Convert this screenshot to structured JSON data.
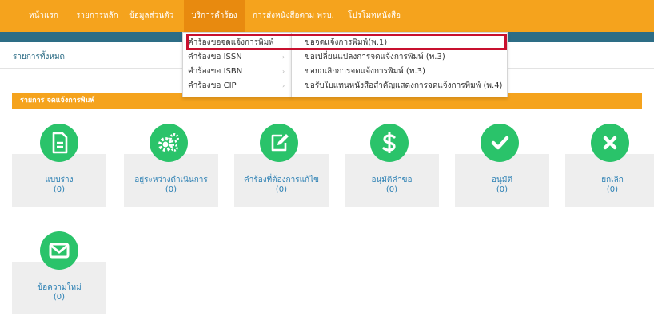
{
  "nav": {
    "items": [
      "หน้าแรก",
      "รายการหลัก",
      "ข้อมูลส่วนตัว",
      "บริการคำร้อง",
      "การส่งหนังสือตาม พรบ.",
      "โปรโมทหนังสือ"
    ]
  },
  "page": {
    "title": "รายการทั้งหมด"
  },
  "section": {
    "label": "รายการ จดแจ้งการพิมพ์"
  },
  "cards": [
    {
      "label": "แบบร่าง",
      "count": "(0)",
      "icon": "document-icon"
    },
    {
      "label": "อยู่ระหว่างดำเนินการ",
      "count": "(0)",
      "icon": "gears-icon"
    },
    {
      "label": "คำร้องที่ต้องการแก้ไข",
      "count": "(0)",
      "icon": "edit-icon"
    },
    {
      "label": "อนุมัติคำขอ",
      "count": "(0)",
      "icon": "dollar-icon"
    },
    {
      "label": "อนุมัติ",
      "count": "(0)",
      "icon": "check-icon"
    },
    {
      "label": "ยกเลิก",
      "count": "(0)",
      "icon": "x-icon"
    },
    {
      "label": "ข้อความใหม่",
      "count": "(0)",
      "icon": "envelope-icon"
    }
  ],
  "menu": {
    "level1": [
      "คำร้องขอจดแจ้งการพิมพ์",
      "คำร้องขอ ISSN",
      "คำร้องขอ ISBN",
      "คำร้องขอ CIP"
    ],
    "level2": [
      "ขอจดแจ้งการพิมพ์(พ.1)",
      "ขอเปลี่ยนแปลงการจดแจ้งการพิมพ์ (พ.3)",
      "ขอยกเลิกการจดแจ้งการพิมพ์ (พ.3)",
      "ขอรับใบแทนหนังสือสำคัญแสดงการจดแจ้งการพิมพ์ (พ.4)"
    ],
    "arrow": "›"
  },
  "colors": {
    "nav": "#f5a31d",
    "teal": "#2d6d86",
    "card_circle": "#2ac36a",
    "card_text": "#2a7fb3",
    "highlight": "#c8102e"
  }
}
